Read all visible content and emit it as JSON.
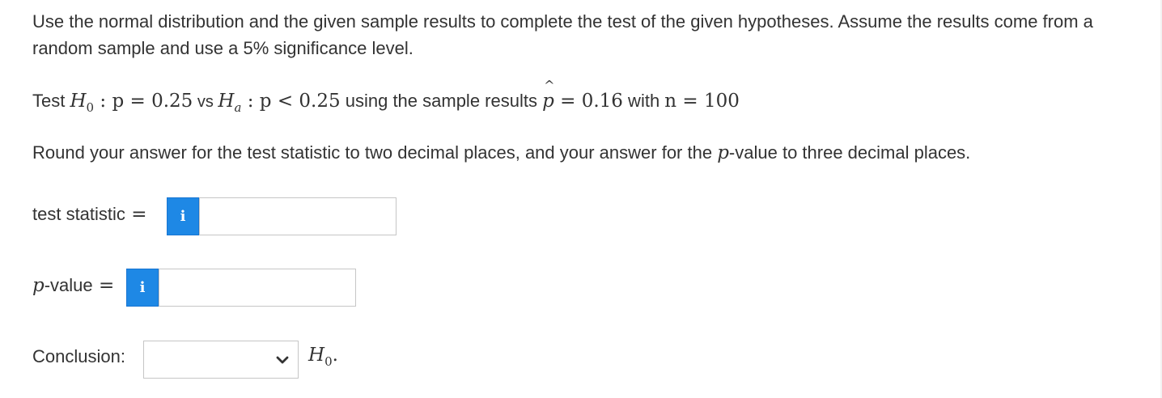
{
  "question": {
    "intro": "Use the normal distribution and the given sample results to complete the test of the given hypotheses. Assume the results come from a random sample and use a 5% significance level.",
    "test_line": {
      "test": "Test ",
      "h0": "H",
      "h0_sub": "0",
      "h0_rel": " : p = 0.25",
      "vs": " vs ",
      "ha": "H",
      "ha_sub": "a",
      "ha_rel": " : p < 0.25",
      "using": " using the sample results ",
      "phat_letter": "p",
      "phat_hat": "^",
      "phat_rel": " = 0.16",
      "with": " with ",
      "n_rel": "n = 100"
    },
    "round_prefix": "Round your answer for the test statistic to two decimal places, and your answer for the ",
    "round_p": "p",
    "round_suffix": "-value to three decimal places."
  },
  "test_statistic": {
    "label": "test statistic",
    "equals": " =",
    "info_icon": "info-icon",
    "info_glyph": "i",
    "value": ""
  },
  "p_value": {
    "label_p": "p",
    "label_rest": "-value",
    "equals": " =",
    "info_icon": "info-icon",
    "info_glyph": "i",
    "value": ""
  },
  "conclusion": {
    "label": "Conclusion:",
    "selected": "",
    "dropdown_icon": "chevron-down-icon",
    "after_h": "H",
    "after_sub": "0",
    "after_punct": "."
  },
  "colors": {
    "info_button": "#1e88e5",
    "text": "#333333",
    "input_border": "#c6c6c6"
  }
}
